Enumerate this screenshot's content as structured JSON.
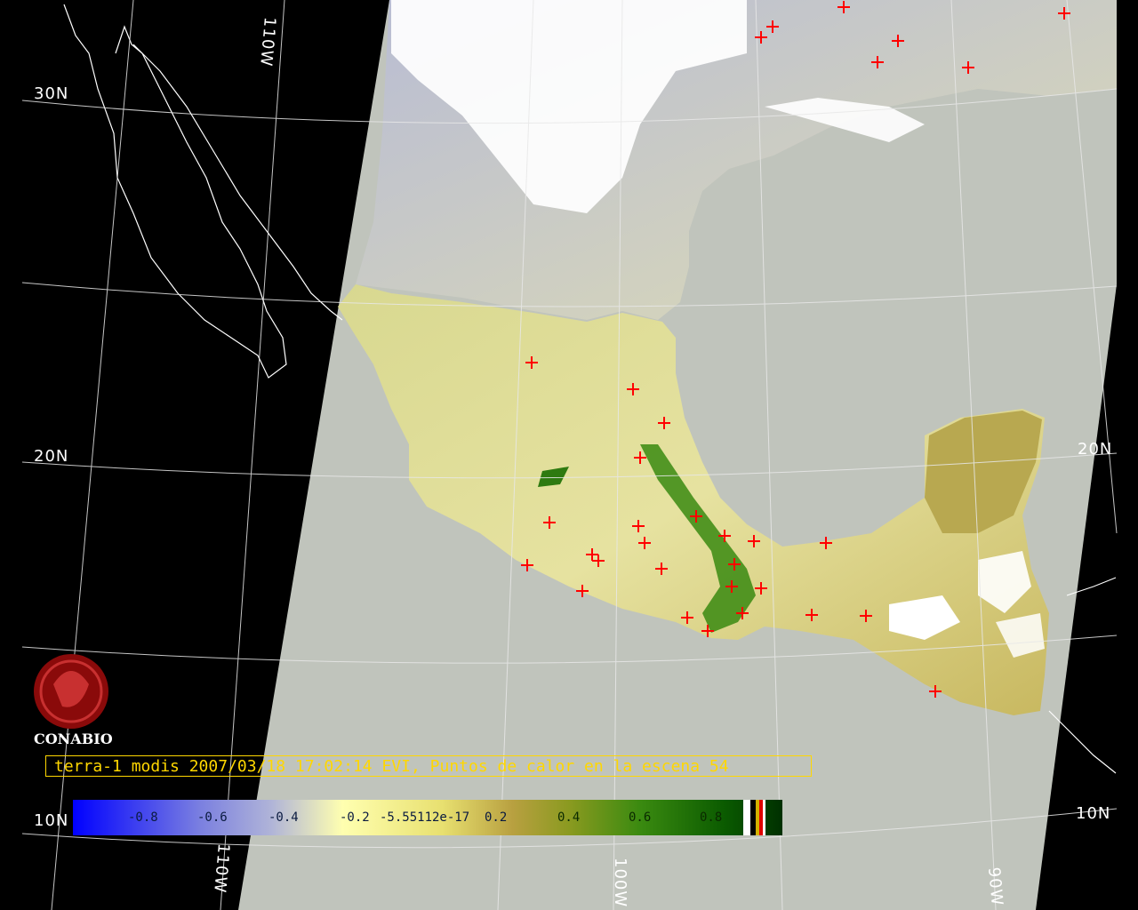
{
  "logo": {
    "text": "CONABIO",
    "icon": "conabio-seal-icon"
  },
  "caption": "terra-1 modis 2007/03/18 17:02:14 EVI, Puntos de calor en la escena 54",
  "grid_labels": {
    "lat_30n": "30N",
    "lat_20n_left": "20N",
    "lat_20n_right": "20N",
    "lat_10n_left": "10N",
    "lat_10n_right": "10N",
    "lon_110w": "110W",
    "lon_100w": "100W",
    "lon_90w": "90W",
    "lon_110w_bottom": "110W"
  },
  "colorbar": {
    "ticks": [
      "-0.8",
      "-0.6",
      "-0.4",
      "-0.2",
      "-5.55112e-17",
      "0.2",
      "0.4",
      "0.6",
      "0.8"
    ],
    "range": [
      -1.0,
      1.0
    ]
  },
  "colors": {
    "background": "#000000",
    "ocean": "#c0c4bc",
    "cloud": "#ffffff",
    "coast": "#ffffff",
    "hotspot": "#ff0000",
    "caption": "#ffd700",
    "logo": "#a01010"
  }
}
